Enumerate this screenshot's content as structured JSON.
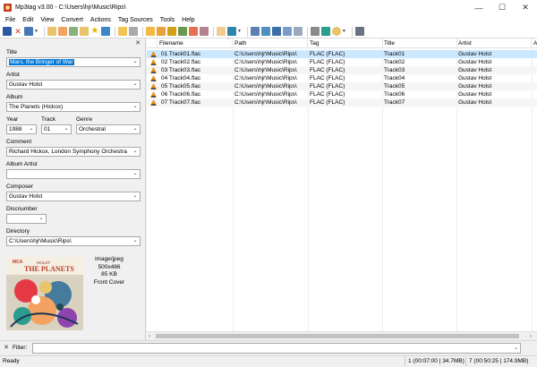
{
  "window": {
    "title": "Mp3tag v3.00  -  C:\\Users\\hjr\\Music\\Rips\\",
    "minimize": "—",
    "maximize": "☐",
    "close": "✕"
  },
  "menu": [
    "File",
    "Edit",
    "View",
    "Convert",
    "Actions",
    "Tag Sources",
    "Tools",
    "Help"
  ],
  "panel": {
    "close": "✕",
    "title_label": "Title",
    "title_value_selected": "Mars, the Bringer of War",
    "artist_label": "Artist",
    "artist_value": "Gustav Holst",
    "album_label": "Album",
    "album_value": "The Planets (Hickox)",
    "year_label": "Year",
    "year_value": "1988",
    "track_label": "Track",
    "track_value": "01",
    "genre_label": "Genre",
    "genre_value": "Orchestral",
    "comment_label": "Comment",
    "comment_value": "Richard Hickox, London Symphony Orchestra",
    "album_artist_label": "Album Artist",
    "album_artist_value": "",
    "composer_label": "Composer",
    "composer_value": "Gustav Holst",
    "discnumber_label": "Discnumber",
    "discnumber_value": "",
    "directory_label": "Directory",
    "directory_value": "C:\\Users\\hjr\\Music\\Rips\\",
    "cover": {
      "label": "MCA",
      "holst": "HOLST",
      "title": "THE PLANETS"
    },
    "image": {
      "type": "image/jpeg",
      "dims": "500x486",
      "size": "85 KB",
      "kind": "Front Cover"
    }
  },
  "grid": {
    "columns": [
      "Filename",
      "Path",
      "Tag",
      "Title",
      "Artist",
      "A"
    ],
    "rows": [
      {
        "filename": "01 Track01.flac",
        "path": "C:\\Users\\hjr\\Music\\Rips\\",
        "tag": "FLAC (FLAC)",
        "title": "Track01",
        "artist": "Gustav Holst"
      },
      {
        "filename": "02 Track02.flac",
        "path": "C:\\Users\\hjr\\Music\\Rips\\",
        "tag": "FLAC (FLAC)",
        "title": "Track02",
        "artist": "Gustav Holst"
      },
      {
        "filename": "03 Track03.flac",
        "path": "C:\\Users\\hjr\\Music\\Rips\\",
        "tag": "FLAC (FLAC)",
        "title": "Track03",
        "artist": "Gustav Holst"
      },
      {
        "filename": "04 Track04.flac",
        "path": "C:\\Users\\hjr\\Music\\Rips\\",
        "tag": "FLAC (FLAC)",
        "title": "Track04",
        "artist": "Gustav Holst"
      },
      {
        "filename": "05 Track05.flac",
        "path": "C:\\Users\\hjr\\Music\\Rips\\",
        "tag": "FLAC (FLAC)",
        "title": "Track05",
        "artist": "Gustav Holst"
      },
      {
        "filename": "06 Track06.flac",
        "path": "C:\\Users\\hjr\\Music\\Rips\\",
        "tag": "FLAC (FLAC)",
        "title": "Track06",
        "artist": "Gustav Holst"
      },
      {
        "filename": "07 Track07.flac",
        "path": "C:\\Users\\hjr\\Music\\Rips\\",
        "tag": "FLAC (FLAC)",
        "title": "Track07",
        "artist": "Gustav Holst"
      }
    ]
  },
  "filter": {
    "close": "✕",
    "label": "Filter:",
    "value": ""
  },
  "status": {
    "left": "Ready",
    "selected": "1 (00:07:00 | 34.7MB)",
    "total": "7 (00:50:25 | 174.9MB)"
  },
  "colors": {
    "selection": "#0078d7",
    "row_selected": "#cce8ff",
    "accent_red": "#c0392b"
  },
  "icons": [
    "save-icon",
    "delete-icon",
    "undo-icon",
    "open-folder-icon",
    "add-folder-icon",
    "favorites-icon",
    "refresh-icon",
    "tag-source-icon",
    "convert-icon",
    "autonumber-icon",
    "export-icon",
    "settings-icon"
  ]
}
